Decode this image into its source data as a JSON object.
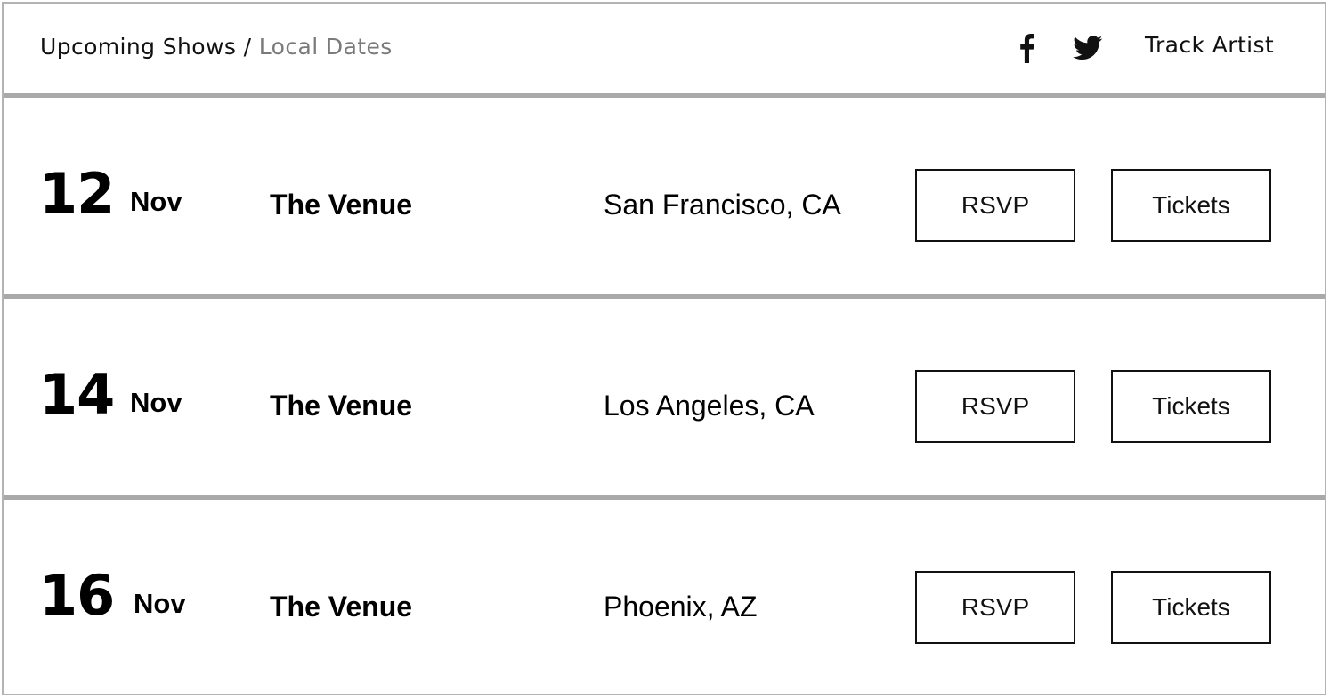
{
  "header": {
    "breadcrumb": {
      "section": "Upcoming Shows",
      "separator": " / ",
      "current": "Local Dates"
    },
    "social": [
      "facebook-icon",
      "twitter-icon"
    ],
    "track_label": "Track Artist"
  },
  "shows": [
    {
      "day": "12",
      "month": "Nov",
      "venue": "The Venue",
      "city": "San Francisco, CA",
      "rsvp_label": "RSVP",
      "tickets_label": "Tickets"
    },
    {
      "day": "14",
      "month": "Nov",
      "venue": "The Venue",
      "city": "Los Angeles, CA",
      "rsvp_label": "RSVP",
      "tickets_label": "Tickets"
    },
    {
      "day": "16",
      "month": "Nov",
      "venue": "The Venue",
      "city": "Phoenix, AZ",
      "rsvp_label": "RSVP",
      "tickets_label": "Tickets"
    }
  ],
  "colors": {
    "text": "#111111",
    "muted": "#7a7a7a",
    "divider": "#a9a9a9",
    "border": "#b3b3b3"
  }
}
